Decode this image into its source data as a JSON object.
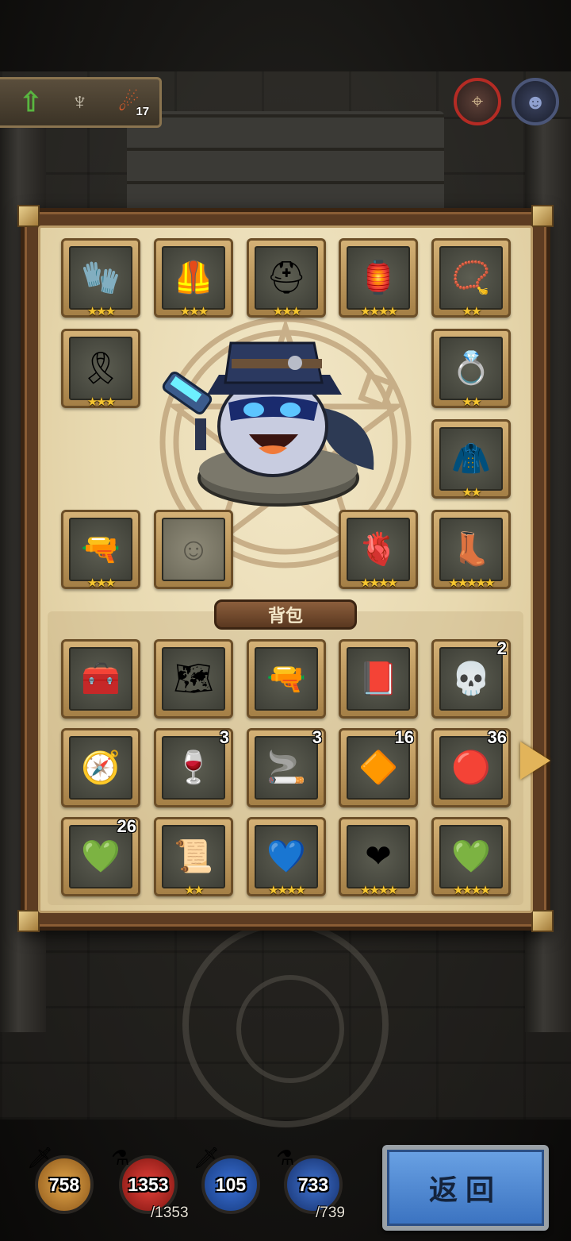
{
  "topbar": {
    "upgrade_icon": "up-arrow-icon",
    "candelabra_icon": "candelabra-icon",
    "fire_icon": "fire-icon",
    "fire_count": "17"
  },
  "corner_buttons": [
    {
      "icon": "map-icon"
    },
    {
      "icon": "portrait-icon"
    }
  ],
  "equipment": [
    {
      "name": "gauntlet",
      "glyph": "🧤",
      "stars": "★★★"
    },
    {
      "name": "armor",
      "glyph": "🦺",
      "stars": "★★★"
    },
    {
      "name": "helmet",
      "glyph": "⛑",
      "stars": "★★★"
    },
    {
      "name": "lantern",
      "glyph": "🏮",
      "stars": "★★★★"
    },
    {
      "name": "amulet",
      "glyph": "📿",
      "stars": "★★"
    },
    {
      "name": "belt",
      "glyph": "🎗",
      "stars": "★★★"
    },
    {
      "name": "ring",
      "glyph": "💍",
      "stars": "★★"
    },
    {
      "name": "cloak",
      "glyph": "🧥",
      "stars": "★★"
    },
    {
      "name": "revolver",
      "glyph": "🔫",
      "stars": "★★★"
    },
    {
      "name": "empty-slot",
      "glyph": "☺",
      "stars": ""
    },
    {
      "name": "heart",
      "glyph": "🫀",
      "stars": "★★★★"
    },
    {
      "name": "boots",
      "glyph": "👢",
      "stars": "★★★★★"
    }
  ],
  "bag": {
    "title": "背包",
    "items": [
      {
        "name": "chest",
        "glyph": "🧰",
        "qty": "",
        "stars": ""
      },
      {
        "name": "map-scroll",
        "glyph": "🗺",
        "qty": "",
        "stars": ""
      },
      {
        "name": "pistol",
        "glyph": "🔫",
        "qty": "",
        "stars": ""
      },
      {
        "name": "book",
        "glyph": "📕",
        "qty": "",
        "stars": ""
      },
      {
        "name": "skull",
        "glyph": "💀",
        "qty": "2",
        "stars": ""
      },
      {
        "name": "compass",
        "glyph": "🧭",
        "qty": "",
        "stars": ""
      },
      {
        "name": "wine-bottle",
        "glyph": "🍷",
        "qty": "3",
        "stars": ""
      },
      {
        "name": "cigarettes",
        "glyph": "🚬",
        "qty": "3",
        "stars": ""
      },
      {
        "name": "orange-crystal",
        "glyph": "🔶",
        "qty": "16",
        "stars": ""
      },
      {
        "name": "red-crystal",
        "glyph": "🔴",
        "qty": "36",
        "stars": ""
      },
      {
        "name": "green-crystal",
        "glyph": "💚",
        "qty": "26",
        "stars": ""
      },
      {
        "name": "rune-scroll",
        "glyph": "📜",
        "qty": "",
        "stars": "★★"
      },
      {
        "name": "blue-heart",
        "glyph": "💙",
        "qty": "",
        "stars": "★★★★"
      },
      {
        "name": "red-heart",
        "glyph": "❤",
        "qty": "",
        "stars": "★★★★"
      },
      {
        "name": "green-heart",
        "glyph": "💚",
        "qty": "",
        "stars": "★★★★"
      }
    ]
  },
  "stats": {
    "attack": "758",
    "hp": "1353",
    "hp_max": "/1353",
    "defense": "105",
    "mp": "733",
    "mp_max": "/739"
  },
  "return_label": "返回",
  "colors": {
    "panel_bg": "#e8d9b0",
    "frame": "#5d3c22",
    "star": "#f6c630",
    "return_btn": "#4a86d4"
  }
}
